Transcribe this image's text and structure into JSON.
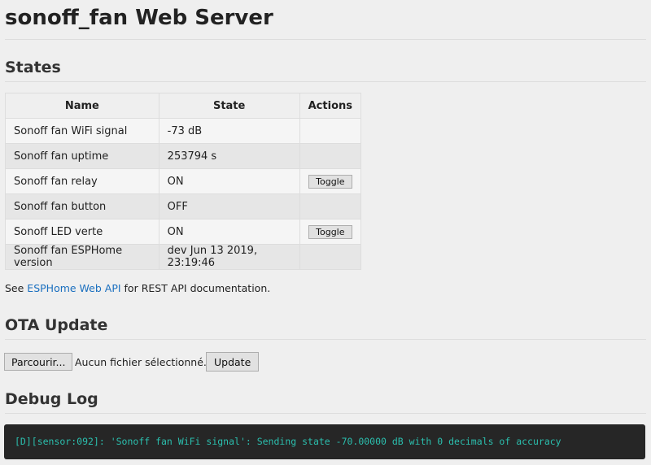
{
  "title": "sonoff_fan Web Server",
  "states": {
    "heading": "States",
    "columns": [
      "Name",
      "State",
      "Actions"
    ],
    "rows": [
      {
        "name": "Sonoff fan WiFi signal",
        "state": "-73 dB",
        "action": ""
      },
      {
        "name": "Sonoff fan uptime",
        "state": "253794 s",
        "action": ""
      },
      {
        "name": "Sonoff fan relay",
        "state": "ON",
        "action": "Toggle"
      },
      {
        "name": "Sonoff fan button",
        "state": "OFF",
        "action": ""
      },
      {
        "name": "Sonoff LED verte",
        "state": "ON",
        "action": "Toggle"
      },
      {
        "name": "Sonoff fan ESPHome version",
        "state": "dev Jun 13 2019, 23:19:46",
        "action": ""
      }
    ]
  },
  "note": {
    "prefix": "See ",
    "link": "ESPHome Web API",
    "suffix": " for REST API documentation."
  },
  "ota": {
    "heading": "OTA Update",
    "browse": "Parcourir...",
    "no_file": "Aucun fichier sélectionné.",
    "update": "Update"
  },
  "debug": {
    "heading": "Debug Log",
    "lines": [
      "[D][sensor:092]: 'Sonoff fan WiFi signal': Sending state -70.00000 dB with 0 decimals of accuracy"
    ]
  }
}
